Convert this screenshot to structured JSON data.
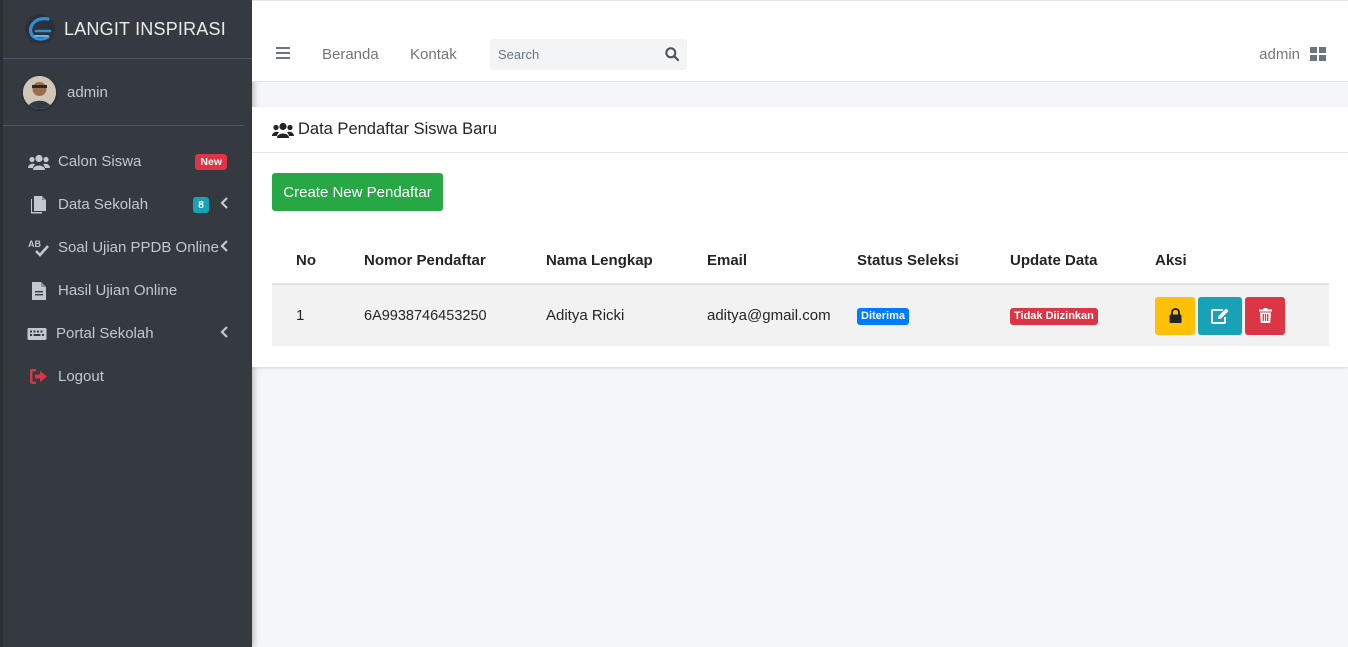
{
  "brand": {
    "name": "LANGIT INSPIRASI"
  },
  "user": {
    "name": "admin"
  },
  "sidebar": {
    "items": [
      {
        "label": "Calon Siswa",
        "icon": "users-icon",
        "badge": "New"
      },
      {
        "label": "Data Sekolah",
        "icon": "copy-icon",
        "badge": "8"
      },
      {
        "label": "Soal Ujian PPDB Online",
        "icon": "spell-check-icon"
      },
      {
        "label": "Hasil Ujian Online",
        "icon": "file-icon"
      },
      {
        "label": "Portal Sekolah",
        "icon": "keyboard-icon"
      },
      {
        "label": "Logout",
        "icon": "sign-out-icon"
      }
    ]
  },
  "topnav": {
    "links": [
      "Beranda",
      "Kontak"
    ],
    "search_placeholder": "Search",
    "user_label": "admin"
  },
  "card": {
    "title": "Data Pendaftar Siswa Baru",
    "create_button": "Create New Pendaftar",
    "table": {
      "headers": [
        "No",
        "Nomor Pendaftar",
        "Nama Lengkap",
        "Email",
        "Status Seleksi",
        "Update Data",
        "Aksi"
      ],
      "rows": [
        {
          "no": "1",
          "nomor": "6A9938746453250",
          "nama": "Aditya Ricki",
          "email": "aditya@gmail.com",
          "status": "Diterima",
          "update": "Tidak Diizinkan"
        }
      ]
    }
  },
  "colors": {
    "sidebar_bg": "#343a40",
    "success": "#28a745",
    "primary": "#007bff",
    "danger": "#dc3545",
    "warning": "#ffc107",
    "info": "#17a2b8"
  }
}
